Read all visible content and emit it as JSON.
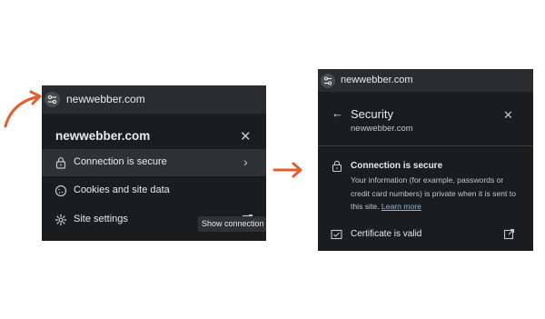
{
  "left": {
    "address": "newwebber.com",
    "popup": {
      "title": "newwebber.com",
      "items": [
        {
          "label": "Connection is secure",
          "icon": "lock-icon"
        },
        {
          "label": "Cookies and site data",
          "icon": "cookie-icon"
        },
        {
          "label": "Site settings",
          "icon": "settings-icon"
        }
      ],
      "tooltip": "Show connection details"
    }
  },
  "right": {
    "address": "newwebber.com",
    "popup": {
      "title": "Security",
      "subtitle": "newwebber.com",
      "connection_title": "Connection is secure",
      "connection_desc": "Your information (for example, passwords or credit card numbers) is private when it is sent to this site.",
      "learn_more": "Learn more",
      "certificate": "Certificate is valid"
    }
  },
  "colors": {
    "arrow": "#e25f2c",
    "panel_bg": "#202124",
    "link": "#8ab4f8"
  }
}
